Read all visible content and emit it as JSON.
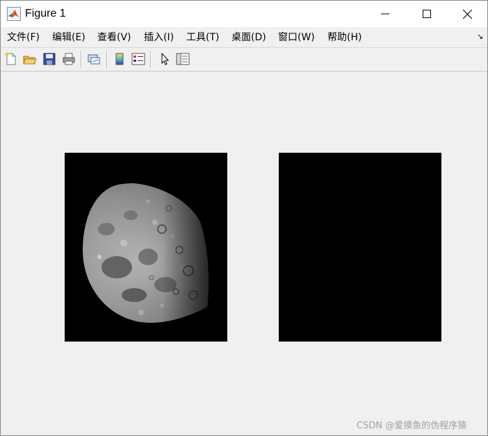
{
  "window": {
    "title": "Figure 1"
  },
  "menu": {
    "items": [
      {
        "label": "文件(F)",
        "icon": ""
      },
      {
        "label": "编辑(E)"
      },
      {
        "label": "查看(V)"
      },
      {
        "label": "插入(I)"
      },
      {
        "label": "工具(T)"
      },
      {
        "label": "桌面(D)"
      },
      {
        "label": "窗口(W)"
      },
      {
        "label": "帮助(H)"
      }
    ]
  },
  "toolbar": {
    "icons": [
      "new-figure-icon",
      "open-file-icon",
      "save-icon",
      "print-icon",
      "link-plot-icon",
      "insert-colorbar-icon",
      "insert-legend-icon",
      "edit-plot-pointer-icon",
      "property-inspector-icon"
    ]
  },
  "figure": {
    "axes": [
      {
        "content": "moon-image"
      },
      {
        "content": "black-image"
      }
    ]
  },
  "watermark": "CSDN @爱摸鱼的伪程序猿",
  "colors": {
    "background": "#f0f0f0",
    "axes_background": "#000000",
    "titlebar": "#ffffff"
  }
}
